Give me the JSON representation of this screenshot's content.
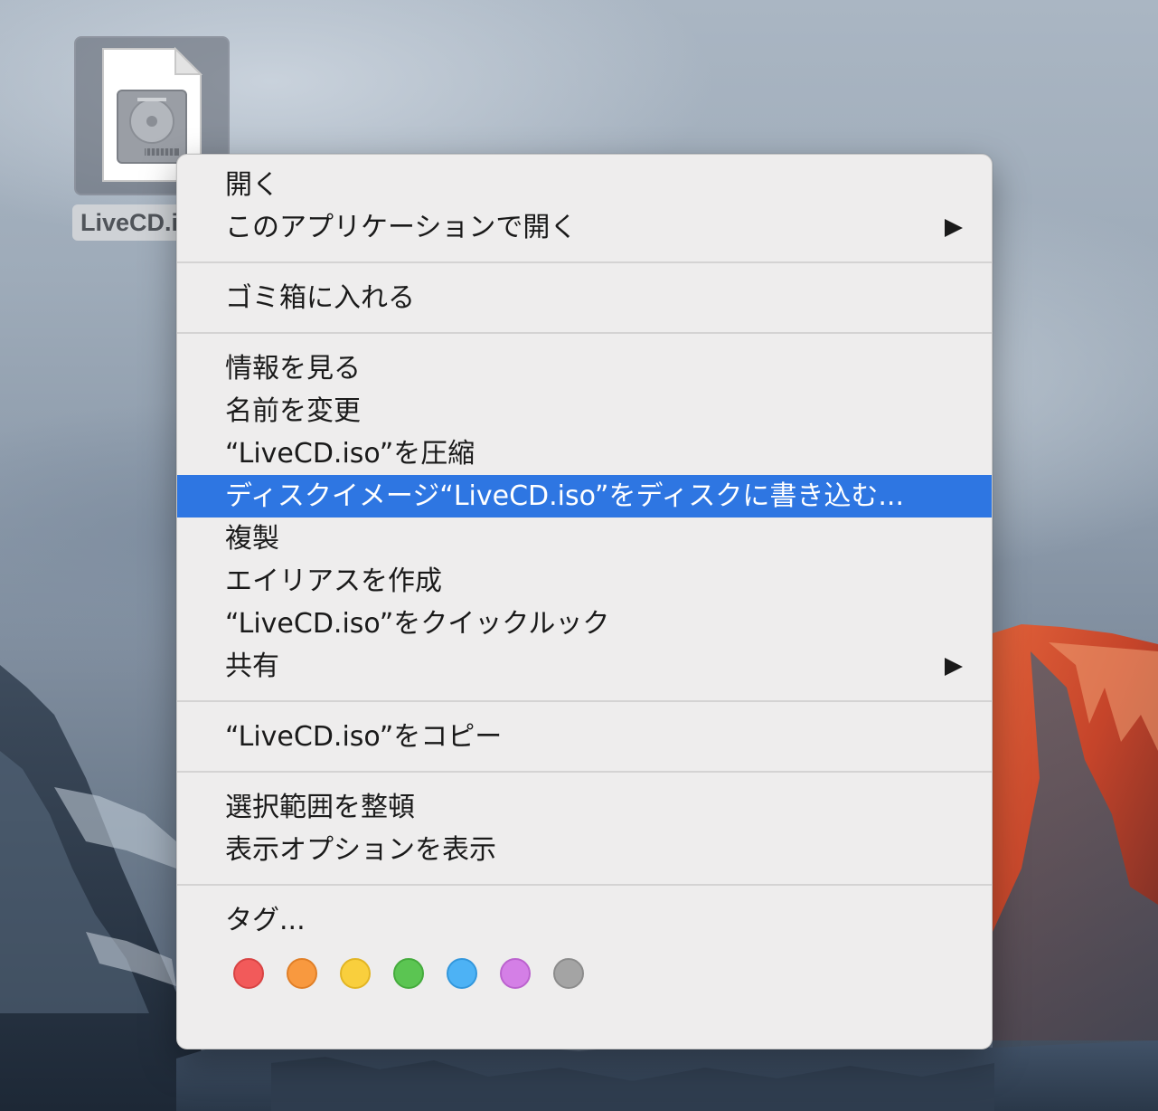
{
  "desktop": {
    "file": {
      "icon": "disk-image-file-icon",
      "label": "LiveCD.iso"
    }
  },
  "context_menu": {
    "groups": [
      {
        "items": [
          {
            "label": "開く",
            "submenu": false
          },
          {
            "label": "このアプリケーションで開く",
            "submenu": true
          }
        ]
      },
      {
        "items": [
          {
            "label": "ゴミ箱に入れる",
            "submenu": false
          }
        ]
      },
      {
        "items": [
          {
            "label": "情報を見る",
            "submenu": false
          },
          {
            "label": "名前を変更",
            "submenu": false
          },
          {
            "label": "“LiveCD.iso”を圧縮",
            "submenu": false
          },
          {
            "label": "ディスクイメージ“LiveCD.iso”をディスクに書き込む...",
            "submenu": false,
            "highlighted": true
          },
          {
            "label": "複製",
            "submenu": false
          },
          {
            "label": "エイリアスを作成",
            "submenu": false
          },
          {
            "label": "“LiveCD.iso”をクイックルック",
            "submenu": false
          },
          {
            "label": "共有",
            "submenu": true
          }
        ]
      },
      {
        "items": [
          {
            "label": "“LiveCD.iso”をコピー",
            "submenu": false
          }
        ]
      },
      {
        "items": [
          {
            "label": "選択範囲を整頓",
            "submenu": false
          },
          {
            "label": "表示オプションを表示",
            "submenu": false
          }
        ]
      },
      {
        "items": [
          {
            "label": "タグ...",
            "submenu": false
          }
        ]
      }
    ],
    "tags": [
      {
        "name": "red",
        "color": "#f25a5a",
        "border": "#d84444"
      },
      {
        "name": "orange",
        "color": "#f8993f",
        "border": "#e07f27"
      },
      {
        "name": "yellow",
        "color": "#f9cf3d",
        "border": "#e2b524"
      },
      {
        "name": "green",
        "color": "#5bc552",
        "border": "#45ab3d"
      },
      {
        "name": "blue",
        "color": "#4db2f5",
        "border": "#3397dc"
      },
      {
        "name": "purple",
        "color": "#d47fe6",
        "border": "#bb63ce"
      },
      {
        "name": "gray",
        "color": "#a4a4a4",
        "border": "#8c8c8c"
      }
    ],
    "highlight_color": "#2e76e2"
  }
}
